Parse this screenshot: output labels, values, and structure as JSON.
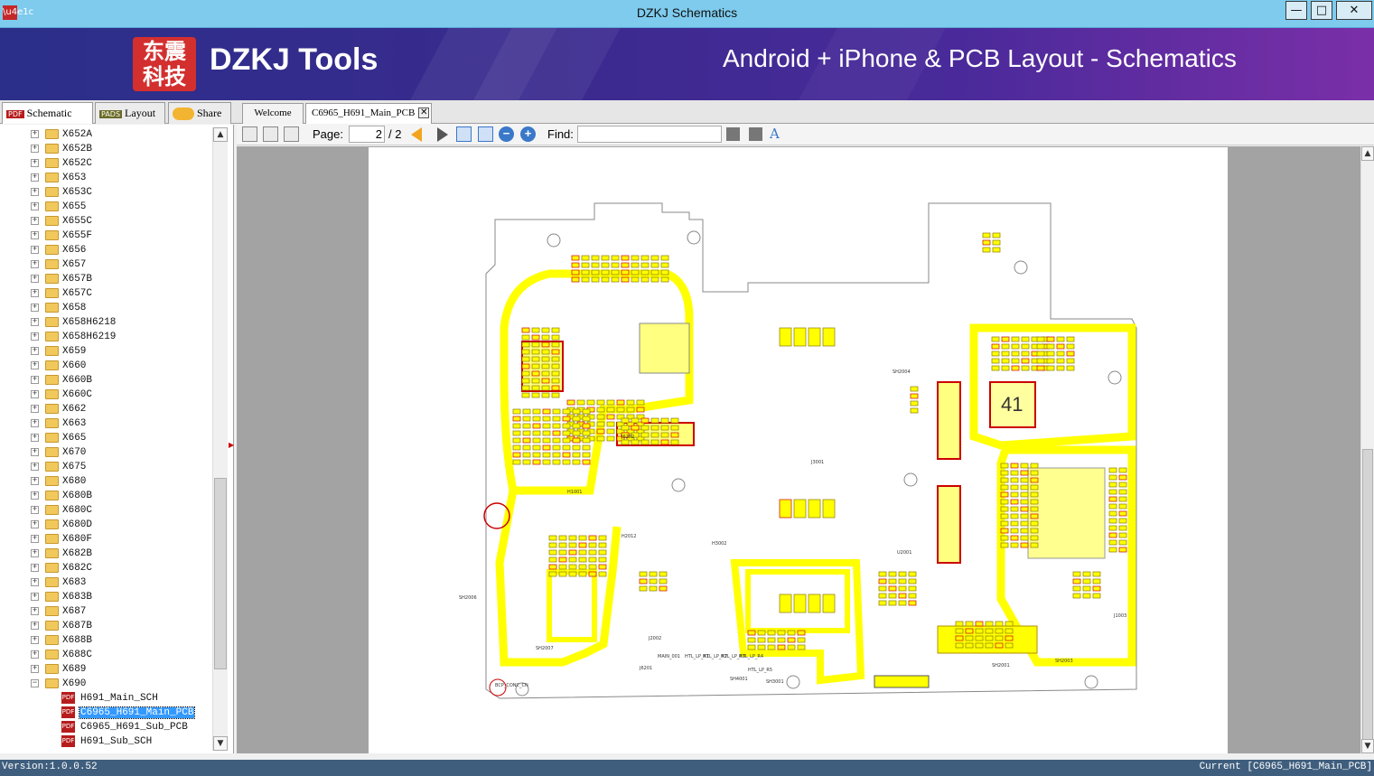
{
  "window": {
    "title": "DZKJ Schematics",
    "app_icon": "app-logo-icon",
    "controls": {
      "minimize": "—",
      "maximize": "□",
      "close": "✕"
    }
  },
  "banner": {
    "logo_text": "东震\n科技",
    "brand": "DZKJ Tools",
    "tagline": "Android + iPhone & PCB Layout - Schematics"
  },
  "left_tabs": [
    {
      "label": "Schematic",
      "icon": "PDF",
      "active": true
    },
    {
      "label": "Layout",
      "icon": "PADS",
      "active": false
    },
    {
      "label": "Share",
      "icon": "cloud-share-icon",
      "active": false
    }
  ],
  "doc_tabs": [
    {
      "label": "Welcome",
      "active": false
    },
    {
      "label": "C6965_H691_Main_PCB",
      "active": true,
      "close": "✕"
    }
  ],
  "toolbar": {
    "page_label": "Page:",
    "page_value": "2",
    "page_total": "/ 2",
    "find_label": "Find:",
    "find_value": ""
  },
  "tree": {
    "folders": [
      "X652A",
      "X652B",
      "X652C",
      "X653",
      "X653C",
      "X655",
      "X655C",
      "X655F",
      "X656",
      "X657",
      "X657B",
      "X657C",
      "X658",
      "X658H6218",
      "X658H6219",
      "X659",
      "X660",
      "X660B",
      "X660C",
      "X662",
      "X663",
      "X665",
      "X670",
      "X675",
      "X680",
      "X680B",
      "X680C",
      "X680D",
      "X680F",
      "X682B",
      "X682C",
      "X683",
      "X683B",
      "X687",
      "X687B",
      "X688B",
      "X688C",
      "X689",
      "X690"
    ],
    "expanded_folder": "X690",
    "files": [
      {
        "label": "H691_Main_SCH",
        "selected": false
      },
      {
        "label": "C6965_H691_Main_PCB",
        "selected": true
      },
      {
        "label": "C6965_H691_Sub_PCB",
        "selected": false
      },
      {
        "label": "H691_Sub_SCH",
        "selected": false
      }
    ],
    "file_icon_text": "PDF"
  },
  "pcb": {
    "center_chip_label": "41",
    "labels": [
      "J6202",
      "J3001",
      "U2001",
      "H3002",
      "H2012",
      "H1001",
      "SH2001",
      "SH2003",
      "SH2004",
      "SH2006",
      "SH2007",
      "SH3001",
      "SH4001",
      "J6201",
      "J2002",
      "J1003",
      "BCP_CONC_CN",
      "MAIN_001",
      "HTL_LP_R1",
      "HTL_LP_R2",
      "HTL_LP_R3",
      "HTL_LP_R4",
      "HTL_LP_R5"
    ]
  },
  "status": {
    "version": "Version:1.0.0.52",
    "current": "Current [C6965_H691_Main_PCB]"
  },
  "colors": {
    "titlebar": "#7ecbee",
    "banner_start": "#2b2f8a",
    "banner_end": "#7a2fa8",
    "pcb_trace": "#ffff00",
    "pcb_outline": "#888888",
    "pcb_component_border": "#d40000",
    "selection": "#3399ff",
    "statusbar": "#3f5e7d"
  }
}
